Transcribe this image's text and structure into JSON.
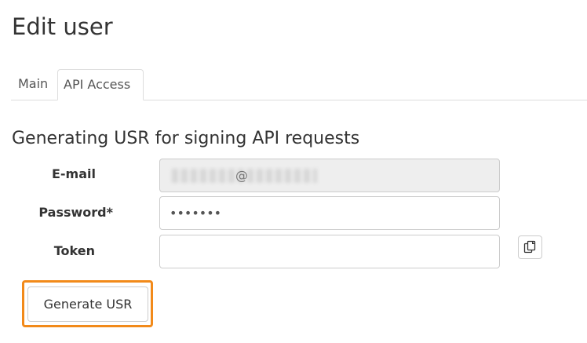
{
  "page": {
    "title": "Edit user"
  },
  "tabs": [
    {
      "label": "Main",
      "active": false
    },
    {
      "label": "API Access",
      "active": true
    }
  ],
  "form": {
    "section_title": "Generating USR for signing API requests",
    "email": {
      "label": "E-mail",
      "value_visible": "@",
      "readonly": true
    },
    "password": {
      "label": "Password*",
      "value": "•••••••"
    },
    "token": {
      "label": "Token",
      "value": ""
    },
    "copy_icon": "copy-icon",
    "generate_label": "Generate USR"
  },
  "colors": {
    "highlight": "#f28a1a",
    "readonly_bg": "#eeeeee",
    "border": "#cccccc"
  }
}
